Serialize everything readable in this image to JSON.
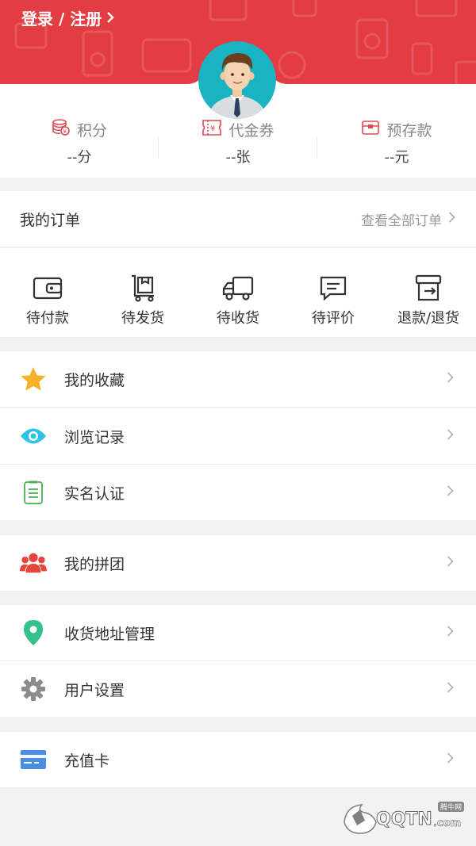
{
  "header": {
    "login_label": "登录 / 注册",
    "accent_color": "#e33d43"
  },
  "stats": [
    {
      "label": "积分",
      "value": "--分",
      "icon": "coins-icon"
    },
    {
      "label": "代金券",
      "value": "--张",
      "icon": "voucher-icon"
    },
    {
      "label": "预存款",
      "value": "--元",
      "icon": "wallet-icon"
    }
  ],
  "orders": {
    "title": "我的订单",
    "view_all": "查看全部订单",
    "items": [
      {
        "label": "待付款",
        "icon": "wallet-icon"
      },
      {
        "label": "待发货",
        "icon": "cart-box-icon"
      },
      {
        "label": "待收货",
        "icon": "truck-icon"
      },
      {
        "label": "待评价",
        "icon": "comment-icon"
      },
      {
        "label": "退款/退货",
        "icon": "return-box-icon"
      }
    ]
  },
  "menu": [
    {
      "label": "我的收藏",
      "icon": "star-icon",
      "color": "#f6b126"
    },
    {
      "label": "浏览记录",
      "icon": "eye-icon",
      "color": "#2ec3e6"
    },
    {
      "label": "实名认证",
      "icon": "id-card-icon",
      "color": "#4caf50"
    },
    {
      "label": "我的拼团",
      "icon": "group-icon",
      "color": "#e8453c"
    },
    {
      "label": "收货地址管理",
      "icon": "location-pin-icon",
      "color": "#36c08e"
    },
    {
      "label": "用户设置",
      "icon": "gear-icon",
      "color": "#8c8c8c"
    },
    {
      "label": "充值卡",
      "icon": "card-icon",
      "color": "#4a90e2"
    }
  ],
  "watermark": {
    "site": "QQTN",
    "suffix": ".com",
    "badge": "腾牛网"
  }
}
